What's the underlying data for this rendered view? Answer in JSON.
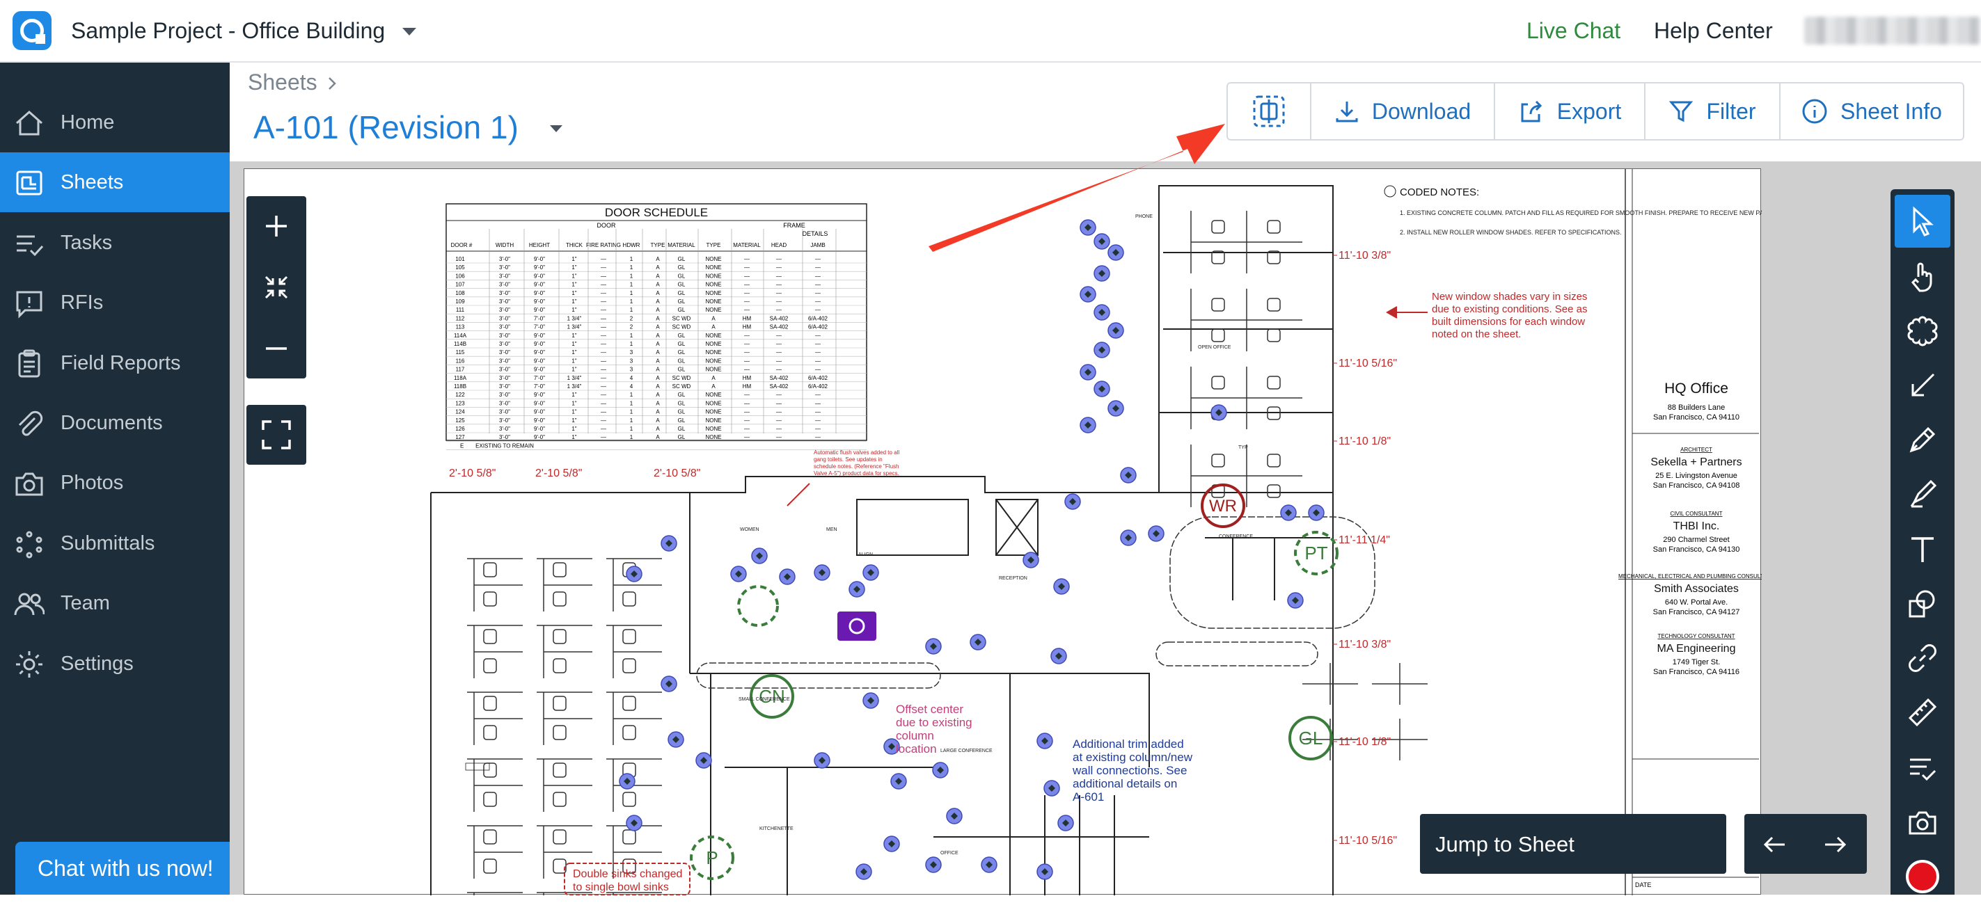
{
  "topbar": {
    "project_name": "Sample Project - Office Building",
    "live_chat": "Live Chat",
    "help_center": "Help Center"
  },
  "sidebar": {
    "items": [
      {
        "label": "Home",
        "icon": "home-icon"
      },
      {
        "label": "Sheets",
        "icon": "sheets-icon",
        "active": true
      },
      {
        "label": "Tasks",
        "icon": "tasks-icon"
      },
      {
        "label": "RFIs",
        "icon": "rfi-icon"
      },
      {
        "label": "Field Reports",
        "icon": "clipboard-icon"
      },
      {
        "label": "Documents",
        "icon": "paperclip-icon"
      },
      {
        "label": "Photos",
        "icon": "camera-icon"
      },
      {
        "label": "Submittals",
        "icon": "submittals-icon"
      },
      {
        "label": "Team",
        "icon": "team-icon"
      },
      {
        "label": "Settings",
        "icon": "gear-icon"
      }
    ],
    "chat_button": "Chat with us now!"
  },
  "header": {
    "breadcrumb": "Sheets",
    "sheet_title": "A-101 (Revision 1)"
  },
  "toolbar": {
    "download": "Download",
    "export": "Export",
    "filter": "Filter",
    "sheet_info": "Sheet Info"
  },
  "viewer": {
    "jump_to_sheet": "Jump to Sheet"
  },
  "drawing": {
    "door_schedule_title": "DOOR SCHEDULE",
    "door_schedule_group_headers": [
      "DOOR",
      "FRAME",
      "DETAILS"
    ],
    "door_schedule_columns": [
      "DOOR #",
      "WIDTH",
      "HEIGHT",
      "THICK",
      "FIRE RATING",
      "HDWR",
      "TYPE",
      "MATERIAL",
      "TYPE",
      "MATERIAL",
      "HEAD",
      "JAMB"
    ],
    "door_schedule_rows": [
      [
        "101",
        "3'-0\"",
        "9'-0\"",
        "1\"",
        "—",
        "1",
        "A",
        "GL",
        "NONE",
        "—",
        "—",
        "—"
      ],
      [
        "105",
        "3'-0\"",
        "9'-0\"",
        "1\"",
        "—",
        "1",
        "A",
        "GL",
        "NONE",
        "—",
        "—",
        "—"
      ],
      [
        "106",
        "3'-0\"",
        "9'-0\"",
        "1\"",
        "—",
        "1",
        "A",
        "GL",
        "NONE",
        "—",
        "—",
        "—"
      ],
      [
        "107",
        "3'-0\"",
        "9'-0\"",
        "1\"",
        "—",
        "1",
        "A",
        "GL",
        "NONE",
        "—",
        "—",
        "—"
      ],
      [
        "108",
        "3'-0\"",
        "9'-0\"",
        "1\"",
        "—",
        "1",
        "A",
        "GL",
        "NONE",
        "—",
        "—",
        "—"
      ],
      [
        "109",
        "3'-0\"",
        "9'-0\"",
        "1\"",
        "—",
        "1",
        "A",
        "GL",
        "NONE",
        "—",
        "—",
        "—"
      ],
      [
        "111",
        "3'-0\"",
        "9'-0\"",
        "1\"",
        "—",
        "1",
        "A",
        "GL",
        "NONE",
        "—",
        "—",
        "—"
      ],
      [
        "112",
        "3'-0\"",
        "7'-0\"",
        "1 3/4\"",
        "—",
        "2",
        "A",
        "SC WD",
        "A",
        "HM",
        "SA-402",
        "6/A-402"
      ],
      [
        "113",
        "3'-0\"",
        "7'-0\"",
        "1 3/4\"",
        "—",
        "2",
        "A",
        "SC WD",
        "A",
        "HM",
        "SA-402",
        "6/A-402"
      ],
      [
        "114A",
        "3'-0\"",
        "9'-0\"",
        "1\"",
        "—",
        "1",
        "A",
        "GL",
        "NONE",
        "—",
        "—",
        "—"
      ],
      [
        "114B",
        "3'-0\"",
        "9'-0\"",
        "1\"",
        "—",
        "1",
        "A",
        "GL",
        "NONE",
        "—",
        "—",
        "—"
      ],
      [
        "115",
        "3'-0\"",
        "9'-0\"",
        "1\"",
        "—",
        "3",
        "A",
        "GL",
        "NONE",
        "—",
        "—",
        "—"
      ],
      [
        "116",
        "3'-0\"",
        "9'-0\"",
        "1\"",
        "—",
        "3",
        "A",
        "GL",
        "NONE",
        "—",
        "—",
        "—"
      ],
      [
        "117",
        "3'-0\"",
        "9'-0\"",
        "1\"",
        "—",
        "3",
        "A",
        "GL",
        "NONE",
        "—",
        "—",
        "—"
      ],
      [
        "118A",
        "3'-0\"",
        "7'-0\"",
        "1 3/4\"",
        "—",
        "4",
        "A",
        "SC WD",
        "A",
        "HM",
        "SA-402",
        "6/A-402"
      ],
      [
        "118B",
        "3'-0\"",
        "7'-0\"",
        "1 3/4\"",
        "—",
        "4",
        "A",
        "SC WD",
        "A",
        "HM",
        "SA-402",
        "6/A-402"
      ],
      [
        "122",
        "3'-0\"",
        "9'-0\"",
        "1\"",
        "—",
        "1",
        "A",
        "GL",
        "NONE",
        "—",
        "—",
        "—"
      ],
      [
        "123",
        "3'-0\"",
        "9'-0\"",
        "1\"",
        "—",
        "1",
        "A",
        "GL",
        "NONE",
        "—",
        "—",
        "—"
      ],
      [
        "124",
        "3'-0\"",
        "9'-0\"",
        "1\"",
        "—",
        "1",
        "A",
        "GL",
        "NONE",
        "—",
        "—",
        "—"
      ],
      [
        "125",
        "3'-0\"",
        "9'-0\"",
        "1\"",
        "—",
        "1",
        "A",
        "GL",
        "NONE",
        "—",
        "—",
        "—"
      ],
      [
        "126",
        "3'-0\"",
        "9'-0\"",
        "1\"",
        "—",
        "1",
        "A",
        "GL",
        "NONE",
        "—",
        "—",
        "—"
      ],
      [
        "127",
        "3'-0\"",
        "9'-0\"",
        "1\"",
        "—",
        "1",
        "A",
        "GL",
        "NONE",
        "—",
        "—",
        "—"
      ],
      [
        "E",
        "EXISTING TO REMAIN",
        "",
        "",
        "",
        "",
        "",
        "",
        "",
        "",
        "",
        ""
      ]
    ],
    "coded_notes_title": "CODED NOTES:",
    "coded_notes": [
      "EXISTING CONCRETE COLUMN. PATCH AND FILL AS REQUIRED FOR SMOOTH FINISH. PREPARE TO RECEIVE NEW PAINT.",
      "INSTALL NEW ROLLER WINDOW SHADES. REFER TO SPECIFICATIONS."
    ],
    "shades_note": [
      "New window shades vary in sizes",
      "due to existing conditions. See as",
      "built dimensions for each window",
      "noted on the sheet."
    ],
    "dimensions_right": [
      "11'-10 3/8\"",
      "11'-10 5/16\"",
      "11'-10 1/8\"",
      "11'-11 1/4\"",
      "11'-10 3/8\"",
      "11'-10 1/8\"",
      "11'-10 5/16\""
    ],
    "dimensions_top": [
      "2'-10 5/8\"",
      "2'-10 5/8\"",
      "2'-10 5/8\""
    ],
    "markers": [
      "WR",
      "PT",
      "CN",
      "GL",
      "P"
    ],
    "offset_note": [
      "Offset center",
      "due to existing",
      "column",
      "location"
    ],
    "trim_note": [
      "Additional trim added",
      "at existing column/new",
      "wall connections. See",
      "additional details on",
      "A-601"
    ],
    "sinks_note": [
      "Double sinks changed",
      "to single bowl sinks"
    ],
    "flush_note": [
      "Automatic flush valves added to all",
      "gang toilets. See updates in",
      "schedule notes. (Reference \"Flush",
      "Valve A-5\") product data for specs."
    ],
    "title_block": {
      "project": "HQ Office",
      "address": [
        "88 Builders Lane",
        "San Francisco, CA 94110"
      ],
      "firms": [
        {
          "role": "ARCHITECT",
          "name": "Sekella + Partners",
          "addr": [
            "25 E. Livingston Avenue",
            "San Francisco, CA 94108"
          ]
        },
        {
          "role": "CIVIL CONSULTANT",
          "name": "THBI Inc.",
          "addr": [
            "290 Charmel Street",
            "San Francisco, CA 94130"
          ]
        },
        {
          "role": "MECHANICAL, ELECTRICAL AND PLUMBING CONSULTANT",
          "name": "Smith Associates",
          "addr": [
            "640 W. Portal Ave.",
            "San Francisco, CA 94127"
          ]
        },
        {
          "role": "TECHNOLOGY CONSULTANT",
          "name": "MA Engineering",
          "addr": [
            "1749 Tiger St.",
            "San Francisco, CA 94116"
          ]
        }
      ],
      "date_label": "DATE"
    },
    "room_labels": [
      "OPEN OFFICE",
      "PHONE",
      "CONFERENCE",
      "RECEPTION",
      "WOMEN",
      "MEN",
      "ALIGN",
      "SMALL CONFERENCE",
      "LARGE CONFERENCE",
      "KITCHENETTE",
      "OFFICE",
      "TYP"
    ]
  },
  "colors": {
    "brand_blue": "#1f8ae6",
    "nav_dark": "#1e2d3a",
    "annotation_red": "#c0292a",
    "marker_green": "#3a7d3a",
    "marker_purple": "#6a1ab0",
    "device_blue": "#7a86e8",
    "live_chat_green": "#2e8a3c"
  }
}
